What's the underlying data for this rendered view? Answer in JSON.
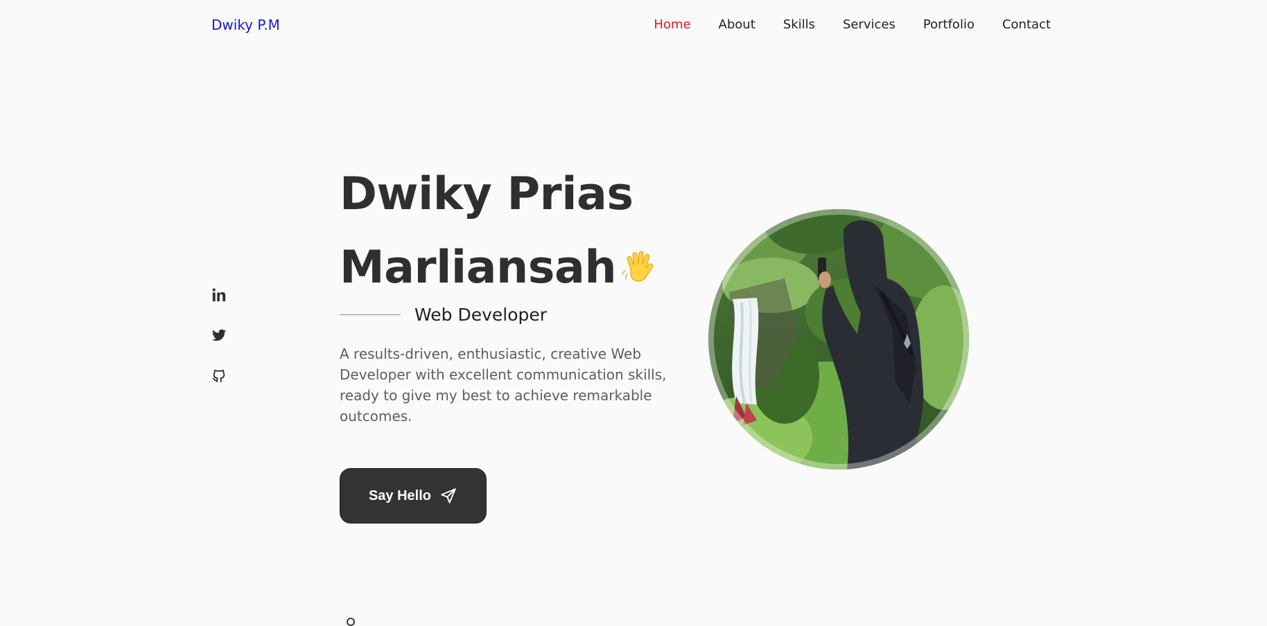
{
  "header": {
    "brand": "Dwiky P.M",
    "brand_color": "#1a18d6",
    "nav": [
      {
        "label": "Home",
        "active": true
      },
      {
        "label": "About",
        "active": false
      },
      {
        "label": "Skills",
        "active": false
      },
      {
        "label": "Services",
        "active": false
      },
      {
        "label": "Portfolio",
        "active": false
      },
      {
        "label": "Contact",
        "active": false
      }
    ],
    "active_color": "#e8121b"
  },
  "socials": [
    {
      "icon": "linkedin-icon"
    },
    {
      "icon": "twitter-icon"
    },
    {
      "icon": "github-icon"
    }
  ],
  "hero": {
    "title_line1": "Dwiky Prias",
    "title_line2": "Marliansah",
    "wave_icon": "waving-hand-icon",
    "subtitle": "Web Developer",
    "description": "A results-driven, enthusiastic, creative Web Developer with excellent communication skills, ready to give my best to achieve remarkable outcomes.",
    "cta_label": "Say Hello",
    "cta_icon": "paper-plane-icon",
    "button_color": "#333333"
  },
  "profile_photo": {
    "icon": "profile-photo"
  }
}
